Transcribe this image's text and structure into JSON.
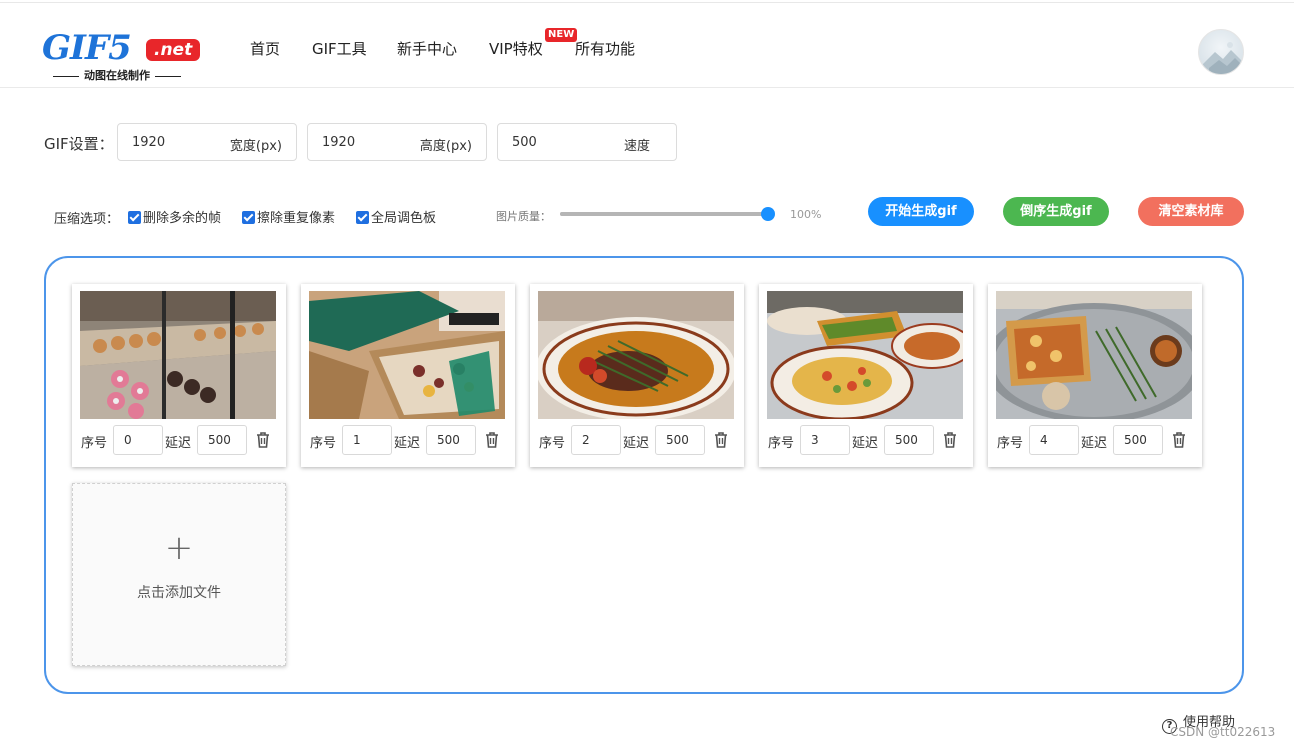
{
  "header": {
    "logo_text": "GIF5",
    "logo_net": ".net",
    "logo_sub": "动图在线制作",
    "nav": [
      {
        "label": "首页"
      },
      {
        "label": "GIF工具"
      },
      {
        "label": "新手中心"
      },
      {
        "label": "VIP特权",
        "badge": "NEW"
      },
      {
        "label": "所有功能"
      }
    ]
  },
  "settings": {
    "label": "GIF设置：",
    "width_value": "1920",
    "width_unit": "宽度(px)",
    "height_value": "1920",
    "height_unit": "高度(px)",
    "speed_value": "500",
    "speed_unit": "速度"
  },
  "compress": {
    "label": "压缩选项：",
    "options": [
      {
        "label": "删除多余的帧",
        "checked": true
      },
      {
        "label": "擦除重复像素",
        "checked": true
      },
      {
        "label": "全局调色板",
        "checked": true
      }
    ],
    "quality_label": "图片质量：",
    "quality_value": "100%",
    "quality_fraction": 1.0
  },
  "actions": {
    "start": "开始生成gif",
    "reverse": "倒序生成gif",
    "clear": "清空素材库"
  },
  "frames": {
    "index_label": "序号",
    "delay_label": "延迟",
    "items": [
      {
        "index": "0",
        "delay": "500",
        "scene": "donut-display-case"
      },
      {
        "index": "1",
        "delay": "500",
        "scene": "food-box"
      },
      {
        "index": "2",
        "delay": "500",
        "scene": "steak-plate"
      },
      {
        "index": "3",
        "delay": "500",
        "scene": "tacos-table"
      },
      {
        "index": "4",
        "delay": "500",
        "scene": "pizza-tray"
      }
    ]
  },
  "add_file": {
    "plus": "+",
    "label": "点击添加文件"
  },
  "footer": {
    "help": "使用帮助",
    "help_icon": "?",
    "watermark": "CSDN @tt022613"
  },
  "colors": {
    "accent_blue": "#1890ff",
    "green": "#4cb750",
    "coral": "#f2705e",
    "panel_border": "#4c95ea",
    "brand_red": "#e8262a"
  }
}
